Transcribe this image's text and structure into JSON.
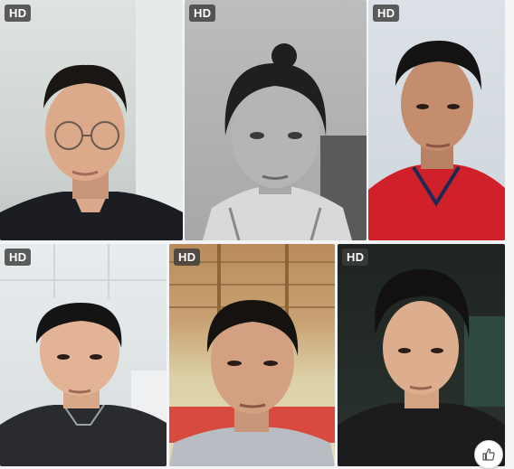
{
  "tiles": [
    {
      "badge": "HD"
    },
    {
      "badge": "HD"
    },
    {
      "badge": "HD"
    },
    {
      "badge": "HD"
    },
    {
      "badge": "HD"
    },
    {
      "badge": "HD"
    }
  ],
  "icons": {
    "like": "thumbs-up-icon"
  },
  "colors": {
    "badge_bg": "#3c3c3c",
    "page_bg": "#f3f4f6"
  }
}
